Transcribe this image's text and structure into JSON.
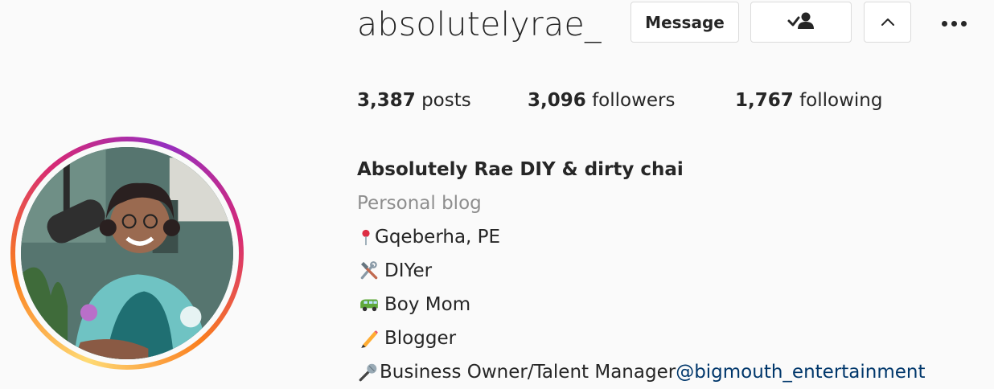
{
  "profile": {
    "username": "absolutelyrae_",
    "actions": {
      "message_label": "Message",
      "follow_icon": "person-check-icon",
      "suggest_icon": "chevron-up-icon",
      "more_icon": "more-horizontal-icon"
    },
    "stats": {
      "posts_count": "3,387",
      "posts_label": " posts",
      "followers_count": "3,096",
      "followers_label": " followers",
      "following_count": "1,767",
      "following_label": " following"
    },
    "bio": {
      "name": "Absolutely Rae DIY & dirty chai",
      "category": "Personal blog",
      "lines": [
        {
          "icon": "round-pushpin-icon",
          "text": "Gqeberha, PE"
        },
        {
          "icon": "hammer-and-wrench-icon",
          "text": " DIYer"
        },
        {
          "icon": "minibus-icon",
          "text": " Boy Mom"
        },
        {
          "icon": "pencil-icon",
          "text": " Blogger"
        },
        {
          "icon": "microphone-icon",
          "text": "Business Owner/Talent Manager ",
          "mention": "@bigmouth_entertainment"
        }
      ]
    }
  },
  "colors": {
    "text": "#262626",
    "secondary": "#8e8e8e",
    "mention": "#00376b",
    "ring_start": "#feda75",
    "ring_end": "#962fbf"
  }
}
